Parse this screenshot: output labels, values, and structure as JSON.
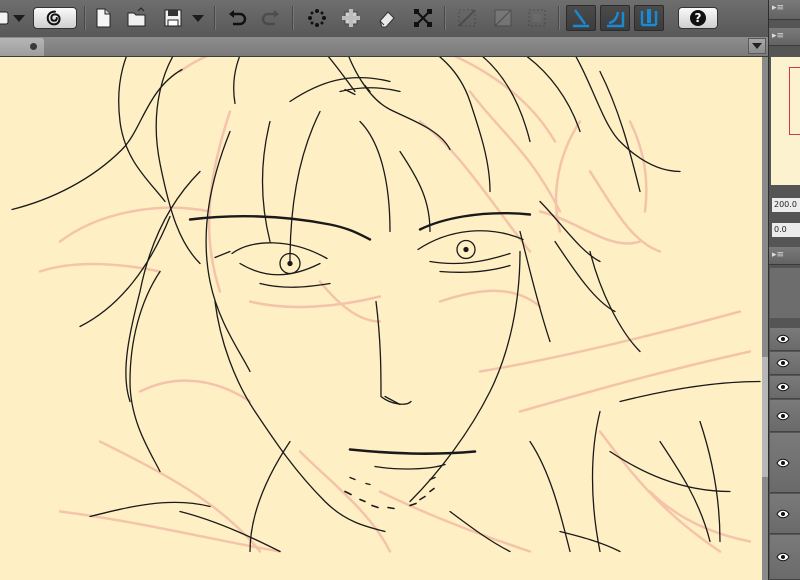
{
  "toolbar": {
    "icons": [
      "clip-studio-icon",
      "new-canvas-icon",
      "open-icon",
      "save-icon",
      "undo-icon",
      "redo-icon",
      "clear-icon",
      "fill-icon",
      "clear-outside-icon",
      "transform-icon",
      "hide-selection-icon",
      "select-all-icon",
      "deselect-icon",
      "snap-to-ruler-icon",
      "snap-to-special-ruler-icon",
      "snap-to-grid-icon",
      "help-icon"
    ],
    "help_label": "?",
    "colors": {
      "bar": "#5e5e5e",
      "active_button": "#3e3e3e",
      "snap_icon": "#1a8ad4"
    }
  },
  "right_panel": {
    "zoom_value": "200.0",
    "angle_value": "0.0",
    "icons": [
      "collapse-icon",
      "eye-icon"
    ]
  },
  "canvas": {
    "background_color": "#fef0c4",
    "line_color": "#1a1a1a",
    "rough_sketch_color": "#f6c2ac"
  }
}
